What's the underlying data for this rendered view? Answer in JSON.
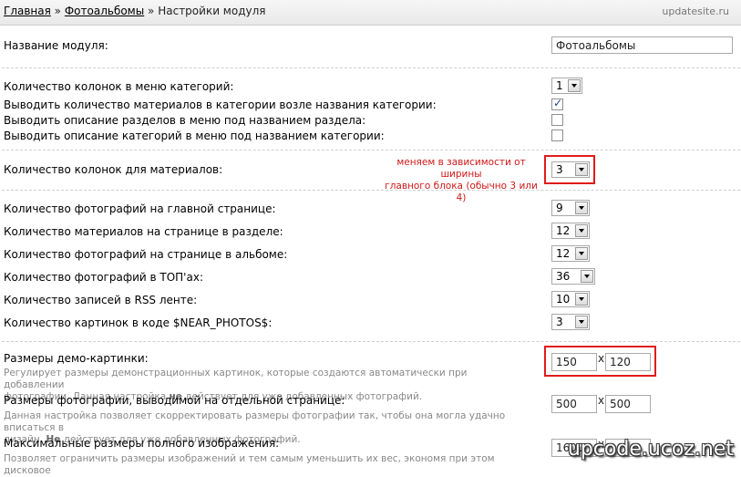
{
  "header": {
    "crumb_home": "Главная",
    "crumb_sep": "»",
    "crumb_albums": "Фотоальбомы",
    "crumb_current": "Настройки модуля",
    "site": "updatesite.ru"
  },
  "settings": {
    "module_name": {
      "label": "Название модуля:",
      "value": "Фотоальбомы"
    },
    "cat_columns": {
      "label": "Количество колонок в меню категорий:",
      "value": "1"
    },
    "show_count": {
      "label": "Выводить количество материалов в категории возле названия категории:",
      "checked": true
    },
    "show_section_desc": {
      "label": "Выводить описание разделов в меню под названием раздела:",
      "checked": false
    },
    "show_cat_desc": {
      "label": "Выводить описание категорий в меню под названием категории:",
      "checked": false
    },
    "mat_columns": {
      "label": "Количество колонок для материалов:",
      "value": "3"
    },
    "photos_main": {
      "label": "Количество фотографий на главной странице:",
      "value": "9"
    },
    "mat_section": {
      "label": "Количество материалов на странице в разделе:",
      "value": "12"
    },
    "photos_album": {
      "label": "Количество фотографий на странице в альбоме:",
      "value": "12"
    },
    "photos_top": {
      "label": "Количество фотографий в ТОП'ах:",
      "value": "36"
    },
    "rss_count": {
      "label": "Количество записей в RSS ленте:",
      "value": "10"
    },
    "near_photos": {
      "label": "Количество картинок в коде $NEAR_PHOTOS$:",
      "value": "3"
    },
    "demo_size": {
      "label": "Размеры демо-картинки:",
      "w": "150",
      "h": "120",
      "desc1": "Регулирует размеры демонстрационных картинок, которые создаются автоматически при добавлении",
      "desc2a": "фотографии. Данная настройка ",
      "desc2b": "не",
      "desc2c": " действует для уже добавленных фотографий."
    },
    "photo_size": {
      "label": "Размеры фотографии, выводимой на отдельной странице:",
      "w": "500",
      "h": "500",
      "desc1": "Данная настройка позволяет скорректировать размеры фотографии так, чтобы она могла удачно вписаться в",
      "desc2a": "дизайн. ",
      "desc2b": "Не",
      "desc2c": " действует для уже добавленных фотографий."
    },
    "max_size": {
      "label": "Максимальные размеры полного изображения:",
      "w": "1600",
      "desc1": "Позволяет ограничить размеры изображений и тем самым уменьшить их вес, экономя при этом дисковое"
    },
    "x_sep": "x"
  },
  "annotation": {
    "note_line1": "меняем в зависимости от ширины",
    "note_line2": "главного блока (обычно 3 или 4)"
  },
  "watermark": "upcode.ucoz.net",
  "colors": {
    "annotation_red": "#e01b1b",
    "muted_text": "#888888"
  }
}
